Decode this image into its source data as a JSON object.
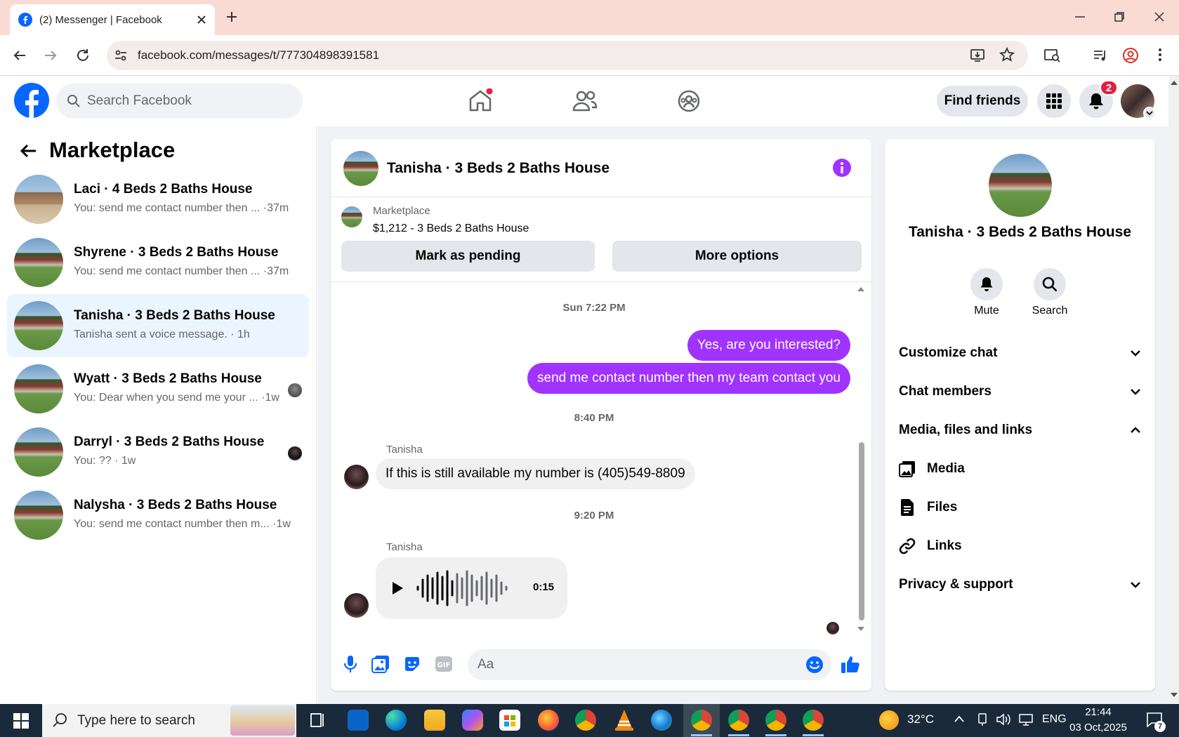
{
  "browser": {
    "tab_title": "(2) Messenger | Facebook",
    "url": "facebook.com/messages/t/777304898391581"
  },
  "header": {
    "search_placeholder": "Search Facebook",
    "find_friends": "Find friends",
    "notification_count": "2"
  },
  "sidebar": {
    "title": "Marketplace",
    "conversations": [
      {
        "name": "Laci · 4 Beds 2 Baths House",
        "preview": "You: send me contact number then ... ·37m"
      },
      {
        "name": "Shyrene · 3 Beds 2 Baths House",
        "preview": "You: send me contact number then ... ·37m"
      },
      {
        "name": "Tanisha · 3 Beds 2 Baths House",
        "preview": "Tanisha sent a voice message. · 1h"
      },
      {
        "name": "Wyatt · 3 Beds 2 Baths House",
        "preview": "You: Dear when you send me your ... ·1w"
      },
      {
        "name": "Darryl · 3 Beds 2 Baths House",
        "preview": "You: ?? · 1w"
      },
      {
        "name": "Nalysha · 3 Beds 2 Baths House",
        "preview": "You: send me contact number then m... ·1w"
      }
    ]
  },
  "chat": {
    "title": "Tanisha · 3 Beds 2 Baths House",
    "listing_label": "Marketplace",
    "listing_detail": "$1,212 - 3 Beds 2 Baths House",
    "mark_pending": "Mark as pending",
    "more_options": "More options",
    "ts1": "Sun 7:22 PM",
    "msg1": "Yes, are you interested?",
    "msg2": "send me contact number then my team contact you",
    "ts2": "8:40 PM",
    "sender1": "Tanisha",
    "msg3": "If this is still available my number is  (405)549-8809",
    "ts3": "9:20 PM",
    "sender2": "Tanisha",
    "voice_duration": "0:15",
    "input_placeholder": "Aa"
  },
  "info": {
    "title": "Tanisha · 3 Beds 2 Baths House",
    "mute": "Mute",
    "search": "Search",
    "customize": "Customize chat",
    "members": "Chat members",
    "media_files": "Media, files and links",
    "media": "Media",
    "files": "Files",
    "links": "Links",
    "privacy": "Privacy & support"
  },
  "taskbar": {
    "search_placeholder": "Type here to search",
    "weather": "32°C",
    "lang": "ENG",
    "time": "21:44",
    "date": "03 Oct,2025",
    "notif_count": "7"
  },
  "colors": {
    "fb_blue": "#0866ff",
    "messenger_purple": "#a033ff",
    "active_row": "#ebf5ff"
  }
}
